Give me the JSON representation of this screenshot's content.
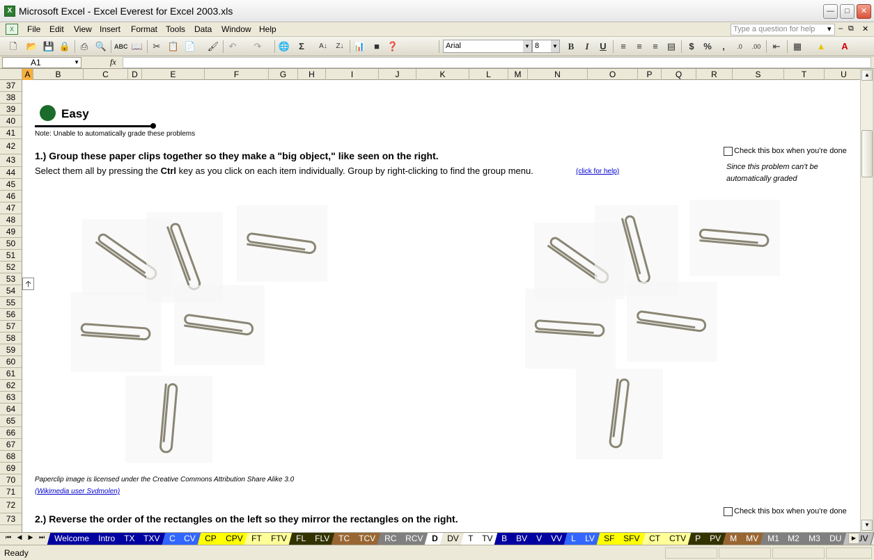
{
  "window": {
    "title": "Microsoft Excel - Excel Everest for Excel 2003.xls"
  },
  "menu": [
    "File",
    "Edit",
    "View",
    "Insert",
    "Format",
    "Tools",
    "Data",
    "Window",
    "Help"
  ],
  "ask_placeholder": "Type a question for help",
  "toolbar": {
    "font_name": "Arial",
    "font_size": "8"
  },
  "formula_bar": {
    "cell_ref": "A1",
    "fx": "fx",
    "value": ""
  },
  "columns": [
    "A",
    "B",
    "C",
    "D",
    "E",
    "F",
    "G",
    "H",
    "I",
    "J",
    "K",
    "L",
    "M",
    "N",
    "O",
    "P",
    "Q",
    "R",
    "S",
    "T",
    "U"
  ],
  "active_column": "A",
  "rows": [
    "37",
    "38",
    "39",
    "40",
    "41",
    "42",
    "43",
    "44",
    "45",
    "46",
    "47",
    "48",
    "49",
    "50",
    "51",
    "52",
    "53",
    "54",
    "55",
    "56",
    "57",
    "58",
    "59",
    "60",
    "61",
    "62",
    "63",
    "64",
    "65",
    "66",
    "67",
    "68",
    "69",
    "70",
    "71",
    "72",
    "73"
  ],
  "content": {
    "section_label": "Easy",
    "note": "Note: Unable to automatically grade these problems",
    "q1_title": "1.) Group these paper clips together so they make a \"big object,\" like seen on the right.",
    "q1_desc_before": "Select them all by pressing the ",
    "q1_desc_key": "Ctrl",
    "q1_desc_after": " key as you click on each item individually. Group by right-clicking to find the group menu.",
    "help_link": "(click for help)",
    "checkbox_label": "Check this box when you're done",
    "side_note": "Since this problem can't be automatically graded",
    "credit": "Paperclip image is licensed under the Creative Commons Attribution Share Alike 3.0",
    "credit_link": "(Wikimedia user Svdmolen)",
    "q2_title": "2.) Reverse the order of the rectangles on the left so they mirror the rectangles on the right."
  },
  "tabs": [
    {
      "label": "Welcome",
      "color": "#0000a0",
      "text": "#ffffff"
    },
    {
      "label": "Intro",
      "color": "#0000a0",
      "text": "#ffffff"
    },
    {
      "label": "TX",
      "color": "#0000a0",
      "text": "#ffffff"
    },
    {
      "label": "TXV",
      "color": "#0000a0",
      "text": "#ffffff"
    },
    {
      "label": "C",
      "color": "#3366ff",
      "text": "#ffffff"
    },
    {
      "label": "CV",
      "color": "#3366ff",
      "text": "#ffffff"
    },
    {
      "label": "CP",
      "color": "#ffff00",
      "text": "#000000"
    },
    {
      "label": "CPV",
      "color": "#ffff00",
      "text": "#000000"
    },
    {
      "label": "FT",
      "color": "#ffff99",
      "text": "#000000"
    },
    {
      "label": "FTV",
      "color": "#ffff99",
      "text": "#000000"
    },
    {
      "label": "FL",
      "color": "#333300",
      "text": "#ffffff"
    },
    {
      "label": "FLV",
      "color": "#333300",
      "text": "#ffffff"
    },
    {
      "label": "TC",
      "color": "#996633",
      "text": "#ffffff"
    },
    {
      "label": "TCV",
      "color": "#996633",
      "text": "#ffffff"
    },
    {
      "label": "RC",
      "color": "#808080",
      "text": "#ffffff"
    },
    {
      "label": "RCV",
      "color": "#808080",
      "text": "#ffffff"
    },
    {
      "label": "D",
      "color": "#ffffff",
      "text": "#000000",
      "active": true
    },
    {
      "label": "DV",
      "color": "#ece9d8",
      "text": "#000000"
    },
    {
      "label": "T",
      "color": "#ffffff",
      "text": "#000000"
    },
    {
      "label": "TV",
      "color": "#ffffff",
      "text": "#000000"
    },
    {
      "label": "B",
      "color": "#0000a0",
      "text": "#ffffff"
    },
    {
      "label": "BV",
      "color": "#0000a0",
      "text": "#ffffff"
    },
    {
      "label": "V",
      "color": "#0000a0",
      "text": "#ffffff"
    },
    {
      "label": "VV",
      "color": "#0000a0",
      "text": "#ffffff"
    },
    {
      "label": "L",
      "color": "#3366ff",
      "text": "#ffffff"
    },
    {
      "label": "LV",
      "color": "#3366ff",
      "text": "#ffffff"
    },
    {
      "label": "SF",
      "color": "#ffff00",
      "text": "#000000"
    },
    {
      "label": "SFV",
      "color": "#ffff00",
      "text": "#000000"
    },
    {
      "label": "CT",
      "color": "#ffff99",
      "text": "#000000"
    },
    {
      "label": "CTV",
      "color": "#ffff99",
      "text": "#000000"
    },
    {
      "label": "P",
      "color": "#333300",
      "text": "#ffffff"
    },
    {
      "label": "PV",
      "color": "#333300",
      "text": "#ffffff"
    },
    {
      "label": "M",
      "color": "#996633",
      "text": "#ffffff"
    },
    {
      "label": "MV",
      "color": "#996633",
      "text": "#ffffff"
    },
    {
      "label": "M1",
      "color": "#808080",
      "text": "#ffffff"
    },
    {
      "label": "M2",
      "color": "#808080",
      "text": "#ffffff"
    },
    {
      "label": "M3",
      "color": "#808080",
      "text": "#ffffff"
    },
    {
      "label": "DU",
      "color": "#808080",
      "text": "#ffffff"
    },
    {
      "label": "DUV",
      "color": "#c0c0c0",
      "text": "#000000"
    }
  ],
  "status": "Ready"
}
